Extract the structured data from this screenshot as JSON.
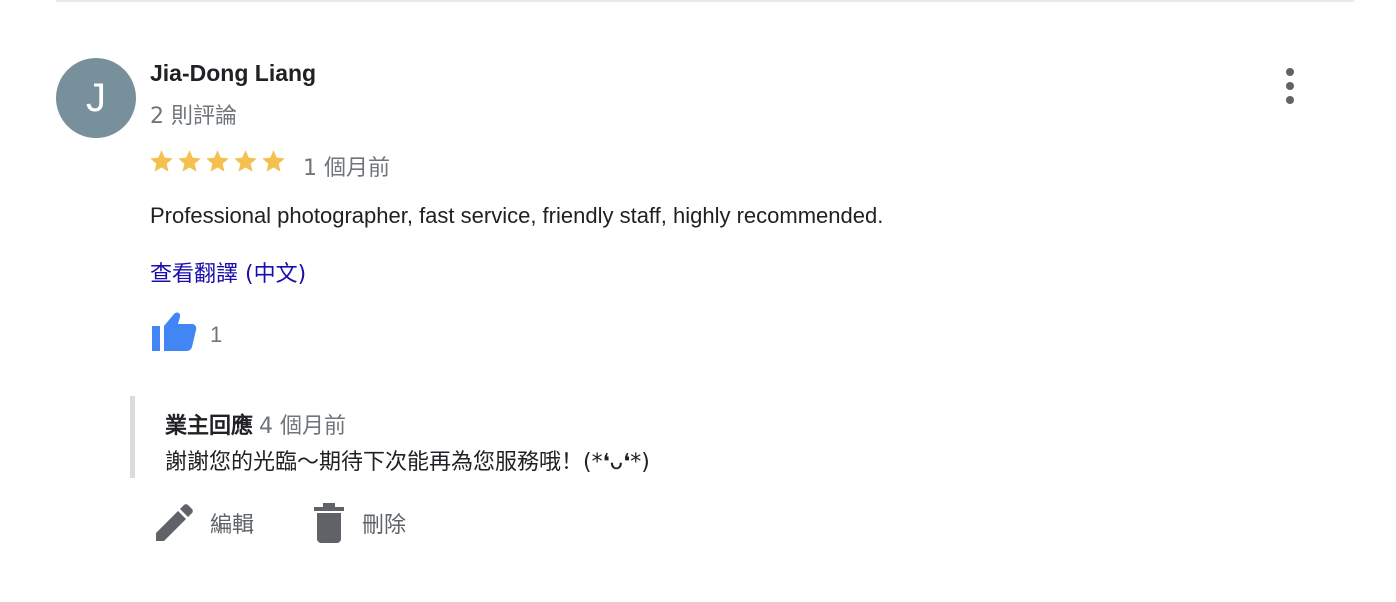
{
  "review": {
    "avatar_initial": "J",
    "reviewer_name": "Jia-Dong Liang",
    "review_count": "2 則評論",
    "rating": 5,
    "rating_max": 5,
    "date": "1 個月前",
    "text": "Professional photographer, fast service, friendly staff, highly recommended.",
    "translate_link": "查看翻譯 (中文)",
    "like_count": "1"
  },
  "owner_reply": {
    "label": "業主回應",
    "date": "4 個月前",
    "text": "謝謝您的光臨～期待下次能再為您服務哦！(*❛ᴗ❛*)"
  },
  "actions": {
    "edit_label": "編輯",
    "delete_label": "刪除"
  },
  "icons": {
    "more": "more-vert-icon",
    "star": "star-icon",
    "like": "thumb-up-icon",
    "edit": "pencil-icon",
    "delete": "trash-icon"
  },
  "colors": {
    "avatar_bg": "#78909c",
    "star": "#f4c150",
    "like": "#4285f4",
    "link": "#1a0dab",
    "secondary_text": "#70757a",
    "icon_gray": "#5f6368"
  }
}
